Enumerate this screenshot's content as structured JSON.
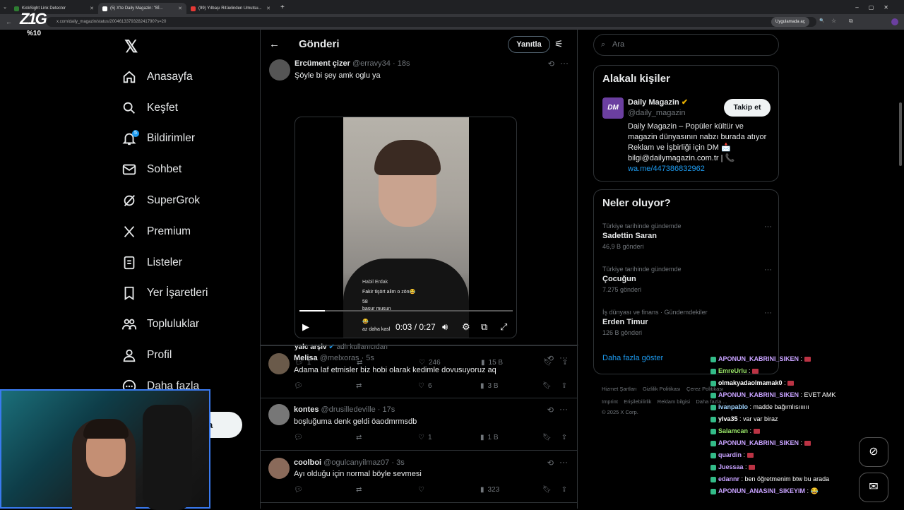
{
  "browser": {
    "tabs": [
      {
        "title": "KickSight Link Detector",
        "color": "#2e7d32",
        "active": false
      },
      {
        "title": "(5) X'te Daily Magazin: \"Bİ...",
        "color": "#000000",
        "active": true
      },
      {
        "title": "(99) Yılbaşı Ritüelinden Umutsu...",
        "color": "#e53935",
        "active": false
      }
    ],
    "url": "x.com/daily_magazin/status/2004613379328241790?s=20",
    "ext_label": "Uygulamada aç"
  },
  "overlay": {
    "logo": "Z1G",
    "percent": "%10"
  },
  "nav": {
    "items": [
      {
        "label": "Anasayfa",
        "icon": "home-icon"
      },
      {
        "label": "Keşfet",
        "icon": "search-icon"
      },
      {
        "label": "Bildirimler",
        "icon": "bell-icon"
      },
      {
        "label": "Sohbet",
        "icon": "mail-icon"
      },
      {
        "label": "SuperGrok",
        "icon": "grok-icon"
      },
      {
        "label": "Premium",
        "icon": "x-icon"
      },
      {
        "label": "Listeler",
        "icon": "list-icon"
      },
      {
        "label": "Yer İşaretleri",
        "icon": "bookmark-icon"
      },
      {
        "label": "Topluluklar",
        "icon": "people-icon"
      },
      {
        "label": "Profil",
        "icon": "person-icon"
      },
      {
        "label": "Daha fazla",
        "icon": "more-icon"
      }
    ],
    "notif_count": "5",
    "post_label": "a"
  },
  "header": {
    "title": "Gönderi",
    "reply_label": "Yanıtla"
  },
  "tweets": [
    {
      "name": "Ercüment çizer",
      "handle": "@erravy34",
      "time": "18s",
      "text": "Şöyle bi şey amk oglu ya",
      "video": {
        "time": "0:03 / 0:27",
        "progress": 0.12,
        "comments": [
          "Fakir tişört alim o zön😂",
          "58",
          "basur musun",
          "😂",
          "az daha kasl"
        ],
        "author_tag": "Habil Erdak"
      },
      "source_name": "yalc arşiv",
      "source_suffix": "adlı kullanıcıdan",
      "replies": "1",
      "retweets": "",
      "likes": "246",
      "views": "15 B"
    },
    {
      "name": "Melisa",
      "handle": "@melxoras",
      "time": "5s",
      "text": "Adama laf etmisler biz hobi olarak kedimle dovusuyoruz aq",
      "replies": "",
      "retweets": "",
      "likes": "6",
      "views": "3 B"
    },
    {
      "name": "kontes",
      "handle": "@drusilledeville",
      "time": "17s",
      "text": "boşluğuma denk geldi öaodmrmsdb",
      "replies": "",
      "retweets": "",
      "likes": "1",
      "views": "1 B"
    },
    {
      "name": "coolboi",
      "handle": "@ogulcanyilmaz07",
      "time": "3s",
      "text": "Ayı olduğu için normal böyle sevmesi",
      "replies": "",
      "retweets": "",
      "likes": "",
      "views": "323"
    }
  ],
  "right": {
    "search_placeholder": "Ara",
    "related_title": "Alakalı kişiler",
    "account": {
      "initials": "DM",
      "name": "Daily Magazin",
      "handle": "@daily_magazin",
      "follow_label": "Takip et",
      "bio": "Daily Magazin – Popüler kültür ve magazin dünyasının nabzı burada atıyor Reklam ve İşbirliği için DM 📩 bilgi@dailymagazin.com.tr | 📞",
      "link": "wa.me/447386832962"
    },
    "trends_title": "Neler oluyor?",
    "trends": [
      {
        "category": "Türkiye tarihinde gündemde",
        "name": "Sadettin Saran",
        "count": "46,9 B gönderi"
      },
      {
        "category": "Türkiye tarihinde gündemde",
        "name": "Çocuğun",
        "count": "7.275 gönderi"
      },
      {
        "category": "İş dünyası ve finans · Gündemdekiler",
        "name": "Erden Timur",
        "count": "126 B gönderi"
      }
    ],
    "more_label": "Daha fazla göster",
    "footer": [
      "Hizmet Şartları",
      "Gizlilik Politikası",
      "Çerez Politikası",
      "Imprint",
      "Erişilebilirlik",
      "Reklam bilgisi",
      "Daha fazla ...",
      "© 2025 X Corp."
    ]
  },
  "chat": [
    {
      "user": "APONUN_KABRINI_SIKEN",
      "msg": "",
      "color": "#c8a2ff"
    },
    {
      "user": "EmreUrlu",
      "msg": "",
      "color": "#9be86a"
    },
    {
      "user": "olmakyadaolmamak0",
      "msg": "",
      "color": "#ffffff"
    },
    {
      "user": "APONUN_KABRINI_SIKEN",
      "msg": "EVET AMK",
      "color": "#c8a2ff"
    },
    {
      "user": "ivanpablo",
      "msg": "madde bağımlısıııııı",
      "color": "#9fd3ff"
    },
    {
      "user": "ylva35",
      "msg": "var var biraz",
      "color": "#ffffff"
    },
    {
      "user": "Salamcan",
      "msg": "",
      "color": "#9be86a"
    },
    {
      "user": "APONUN_KABRINI_SIKEN",
      "msg": "",
      "color": "#c8a2ff"
    },
    {
      "user": "quardin",
      "msg": "",
      "color": "#c8a2ff"
    },
    {
      "user": "Juessaa",
      "msg": "",
      "color": "#c8a2ff"
    },
    {
      "user": "edannr",
      "msg": "ben öğretmenim btw bu arada",
      "color": "#c8a2ff"
    },
    {
      "user": "APONUN_ANASINI_SIKEYIM",
      "msg": "😂",
      "color": "#c8a2ff"
    }
  ],
  "colors": {
    "accent": "#1d9bf0",
    "bg": "#000000",
    "border": "#2f3336",
    "muted": "#71767b"
  }
}
